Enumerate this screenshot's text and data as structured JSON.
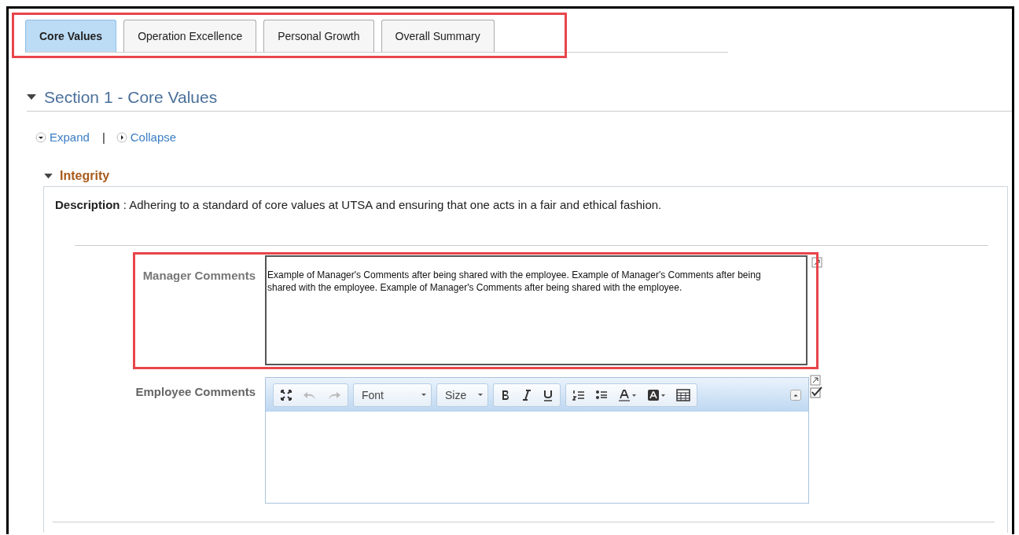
{
  "tabs": [
    {
      "label": "Core Values",
      "selected": true
    },
    {
      "label": "Operation Excellence",
      "selected": false
    },
    {
      "label": "Personal Growth",
      "selected": false
    },
    {
      "label": "Overall Summary",
      "selected": false
    }
  ],
  "section": {
    "title": "Section 1 - Core Values",
    "expanded": true
  },
  "links": [
    {
      "label": "Expand",
      "kind": "expand"
    },
    {
      "label": "Collapse",
      "kind": "collapse"
    }
  ],
  "separator": "|",
  "category": {
    "title": "Integrity",
    "expanded": true,
    "description_label": "Description",
    "description_separator": ":",
    "description": "Adhering to a standard of core values at UTSA and ensuring that one acts in a fair and ethical fashion."
  },
  "manager_comments": {
    "label": "Manager Comments",
    "value": "Example of Manager's Comments after being shared with the employee. Example of Manager's Comments after being shared with the employee. Example of Manager's Comments after being shared with the employee."
  },
  "employee_comments": {
    "label": "Employee Comments",
    "toolbar": {
      "undo_disabled": true,
      "redo_disabled": true,
      "font": "Font",
      "size": "Size"
    }
  }
}
